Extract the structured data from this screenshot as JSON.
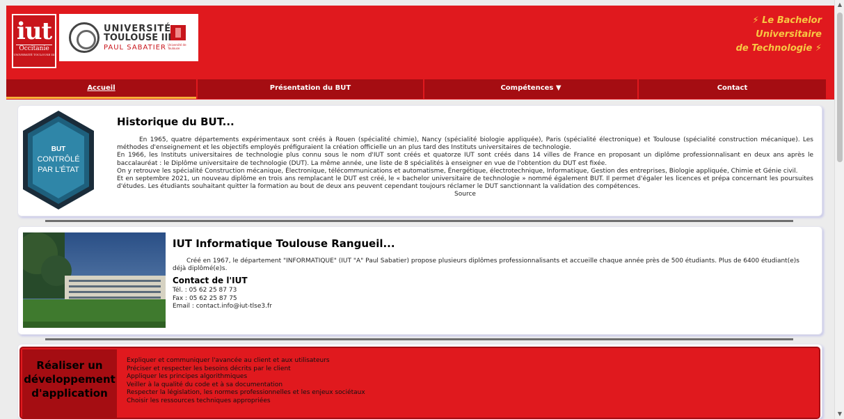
{
  "header": {
    "iut_logo": {
      "big": "iut",
      "sub": "Occitanie",
      "tiny": "UNIVERSITÉ TOULOUSE III"
    },
    "ut_logo": {
      "line1": "UNIVERSITÉ",
      "line2": "TOULOUSE III",
      "line3": "PAUL SABATIER",
      "small": "Université de Toulouse"
    },
    "bachelor_logo": {
      "line1": "Le Bachelor",
      "line2": "Universitaire",
      "line3": "de Technologie"
    }
  },
  "nav": {
    "tabs": [
      {
        "label": "Accueil",
        "active": true
      },
      {
        "label": "Présentation du BUT"
      },
      {
        "label": "Compétences ▼"
      },
      {
        "label": "Contact"
      }
    ]
  },
  "historique": {
    "badge": {
      "l1": "BUT",
      "l2": "CONTRÔLÉ",
      "l3": "PAR L'ÉTAT"
    },
    "title": "Historique du BUT...",
    "p1": "En 1965, quatre départements expérimentaux sont créés à Rouen (spécialité chimie), Nancy (spécialité biologie appliquée), Paris (spécialité électronique) et Toulouse (spécialité construction mécanique). Les méthodes d'enseignement et les objectifs employés préfiguraient la création officielle un an plus tard des Instituts universitaires de technologie.",
    "p2": "En 1966, les Instituts universitaires de technologie plus connu sous le nom d'IUT sont créés et quatorze IUT sont créés dans 14 villes de France en proposant un diplôme professionnalisant en deux ans après le baccalauréat : le Diplôme universitaire de technologie (DUT). La même année, une liste de 8 spécialités à enseigner en vue de l'obtention du DUT est fixée.",
    "p3": "On y retrouve les spécialité Construction mécanique, Électronique, télécommunications et automatisme, Énergétique, électrotechnique, Informatique, Gestion des entreprises, Biologie appliquée, Chimie et Génie civil.",
    "p4": "Et en septembre 2021, un nouveau diplôme en trois ans remplacant le DUT est créé, le « bachelor universitaire de technologie » nommé également BUT. Il permet d'égaler les licences et prépa concernant les poursuites d'études. Les étudiants souhaitant quitter la formation au bout de deux ans peuvent cependant toujours réclamer le DUT sanctionnant la validation des compétences.",
    "source": "Source"
  },
  "iut": {
    "title": "IUT Informatique Toulouse Rangueil...",
    "text": "Créé en 1967, le département \"INFORMATIQUE\" (IUT \"A\" Paul Sabatier) propose plusieurs diplômes professionnalisants et accueille chaque année près de 500 étudiants. Plus de 6400 étudiant(e)s déjà diplômé(e)s.",
    "contact_title": "Contact de l'IUT",
    "tel": "Tél. : 05 62 25 87 73",
    "fax": "Fax : 05 62 25 87 75",
    "email": "Email : contact.info@iut-tlse3.fr"
  },
  "competence": {
    "title": "Réaliser un développement d'application",
    "items": [
      "Expliquer et communiquer l'avancée au client et aux utilisateurs",
      "Préciser et respecter les besoins décrits par le client",
      "Appliquer les principes algorithmiques",
      "Veiller à la qualité du code et à sa documentation",
      "Respecter la législation, les normes professionnelles et les enjeux sociétaux",
      "Choisir les ressources techniques appropriées"
    ]
  },
  "colors": {
    "header_red": "#e0191e",
    "nav_dark_red": "#a50d12",
    "active_underline": "#f7b13a",
    "bachelor_yellow": "#f7c843",
    "hex_blue": "#1e5f7c"
  }
}
